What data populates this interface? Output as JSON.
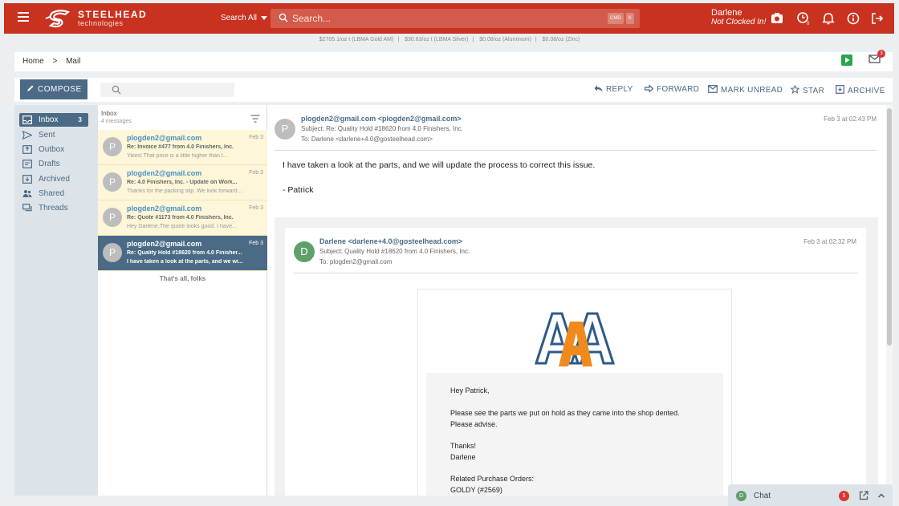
{
  "brand": {
    "name": "STEELHEAD",
    "sub": "technologies"
  },
  "topbar": {
    "search_scope": "Search All",
    "search_placeholder": "Search...",
    "kbd_cmd": "CMD",
    "kbd_k": "K",
    "user_name": "Darlene",
    "user_status": "Not Clocked In!",
    "clock_sub": "0"
  },
  "ticker": [
    "$2705.1/oz t (LBMA Gold AM)",
    "$30.63/oz t (LBMA Silver)",
    "$0.08/oz (Aluminum)",
    "$0.08/oz (Zinc)"
  ],
  "breadcrumb": {
    "home": "Home",
    "sep": ">",
    "current": "Mail"
  },
  "mail_badge": "3",
  "toolbar": {
    "compose": "COMPOSE",
    "reply": "REPLY",
    "forward": "FORWARD",
    "mark_unread": "MARK UNREAD",
    "star": "STAR",
    "archive": "ARCHIVE"
  },
  "sidebar": {
    "items": [
      {
        "label": "Inbox",
        "badge": "3"
      },
      {
        "label": "Sent"
      },
      {
        "label": "Outbox"
      },
      {
        "label": "Drafts"
      },
      {
        "label": "Archived"
      },
      {
        "label": "Shared"
      },
      {
        "label": "Threads"
      }
    ]
  },
  "list": {
    "title": "Inbox",
    "count": "4 messages",
    "end_note": "That's all, folks",
    "messages": [
      {
        "initial": "P",
        "from": "plogden2@gmail.com",
        "date": "Feb 3",
        "subject": "Re: Invoice #477 from 4.0 Finishers, Inc.",
        "preview": "Yikes! That price is a little higher than I..."
      },
      {
        "initial": "P",
        "from": "plogden2@gmail.com",
        "date": "Feb 3",
        "subject": "Re: 4.0 Finishers, Inc. - Update on Work...",
        "preview": "Thanks for the packing slip. We look forward ..."
      },
      {
        "initial": "P",
        "from": "plogden2@gmail.com",
        "date": "Feb 3",
        "subject": "Re: Quote #1173 from 4.0 Finishers, Inc.",
        "preview": "Hey Darlene,The quote looks good. I have..."
      },
      {
        "initial": "P",
        "from": "plogden2@gmail.com",
        "date": "Feb 3",
        "subject": "Re: Quality Hold #18620 from 4.0 Finisher...",
        "preview": "I have taken a look at the parts, and we wi..."
      }
    ]
  },
  "reader": {
    "initial": "P",
    "from": "plogden2@gmail.com <plogden2@gmail.com>",
    "subject": "Subject: Re: Quality Hold #18620 from 4.0 Finishers, Inc.",
    "to": "To: Darlene <darlene+4.0@gosteelhead.com>",
    "date": "Feb 3 at 02:43 PM",
    "body": "I have taken a look at the parts, and we will update the process to correct this issue.",
    "sign": "- Patrick",
    "quoted": {
      "initial": "D",
      "from": "Darlene <darlene+4.0@gosteelhead.com>",
      "subject": "Subject: Quality Hold #18620 from 4.0 Finishers, Inc.",
      "to": "To: plogden2@gmail.com",
      "date": "Feb 3 at 02:32 PM",
      "greeting": "Hey Patrick,",
      "line1": "Please see the parts we put on hold as they came into the shop dented.",
      "line2": "Please advise.",
      "thanks": "Thanks!",
      "name": "Darlene",
      "po_label": "Related Purchase Orders:",
      "po": "GOLDY (#2569)"
    }
  },
  "chat": {
    "initial": "D",
    "label": "Chat",
    "badge": "5"
  },
  "colors": {
    "brand_red": "#c9321f",
    "accent": "#4a6a85",
    "link": "#4a90c2",
    "unread_bg": "#fdf6d8"
  }
}
